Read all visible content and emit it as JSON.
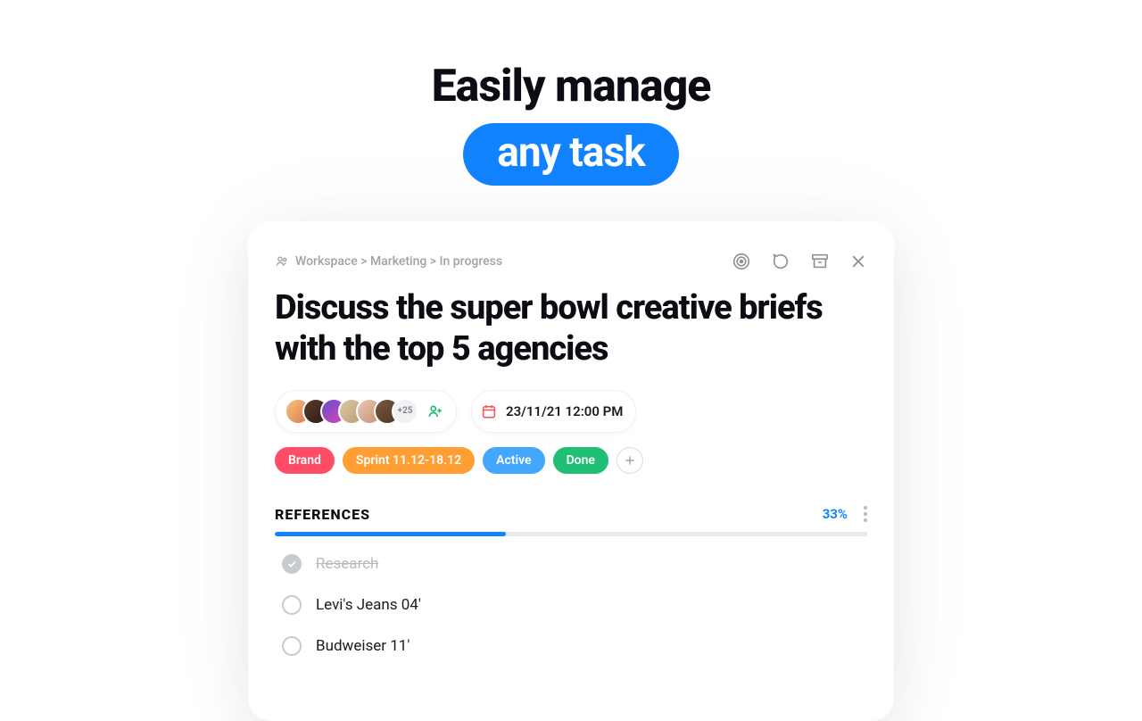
{
  "hero": {
    "line1": "Easily manage",
    "pill": "any task"
  },
  "breadcrumb": {
    "text": "Workspace > Marketing > In progress"
  },
  "task": {
    "title": "Discuss the super bowl creative briefs with the top 5 agencies"
  },
  "people": {
    "overflow": "+25"
  },
  "schedule": {
    "datetime": "23/11/21 12:00 PM"
  },
  "tags": {
    "brand": "Brand",
    "sprint": "Sprint 11.12-18.12",
    "active": "Active",
    "done": "Done"
  },
  "references": {
    "heading": "REFERENCES",
    "percent": "33%",
    "items": [
      {
        "label": "Research",
        "done": true
      },
      {
        "label": "Levi's Jeans 04'",
        "done": false
      },
      {
        "label": "Budweiser 11'",
        "done": false
      }
    ]
  }
}
